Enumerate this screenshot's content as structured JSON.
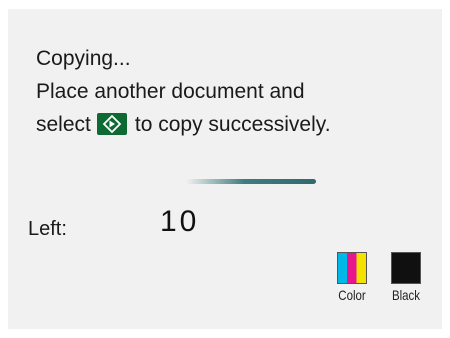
{
  "message": {
    "line1": "Copying...",
    "line2": "Place another document and",
    "line3_before": "select",
    "line3_after": "to copy successively.",
    "start_key_icon": "start-key-icon"
  },
  "counter": {
    "label": "Left:",
    "value": "10"
  },
  "ink": {
    "color_label": "Color",
    "black_label": "Black",
    "color_icon": "color-ink-tank-icon",
    "black_icon": "black-ink-tank-icon"
  },
  "colors": {
    "screen_bg": "#f2f1f1",
    "start_key": "#0d6a33",
    "progress": "#2f6a70",
    "ink_cyan": "#00b8e8",
    "ink_magenta": "#e8168c",
    "ink_yellow": "#f5e100",
    "ink_black": "#101010"
  }
}
